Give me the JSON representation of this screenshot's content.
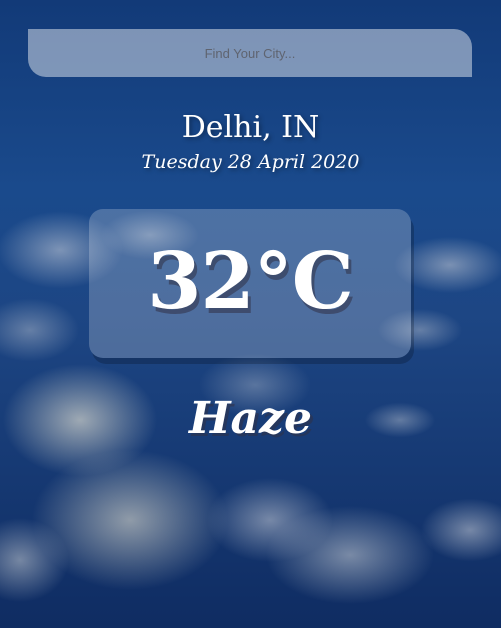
{
  "search": {
    "placeholder": "Find Your City..."
  },
  "location": {
    "city_country": "Delhi, IN",
    "date": "Tuesday 28 April 2020"
  },
  "weather": {
    "temperature": "32°C",
    "condition": "Haze"
  },
  "colors": {
    "background_top": "#123a78",
    "background_bottom": "#0f2c62",
    "text": "#ffffff"
  }
}
